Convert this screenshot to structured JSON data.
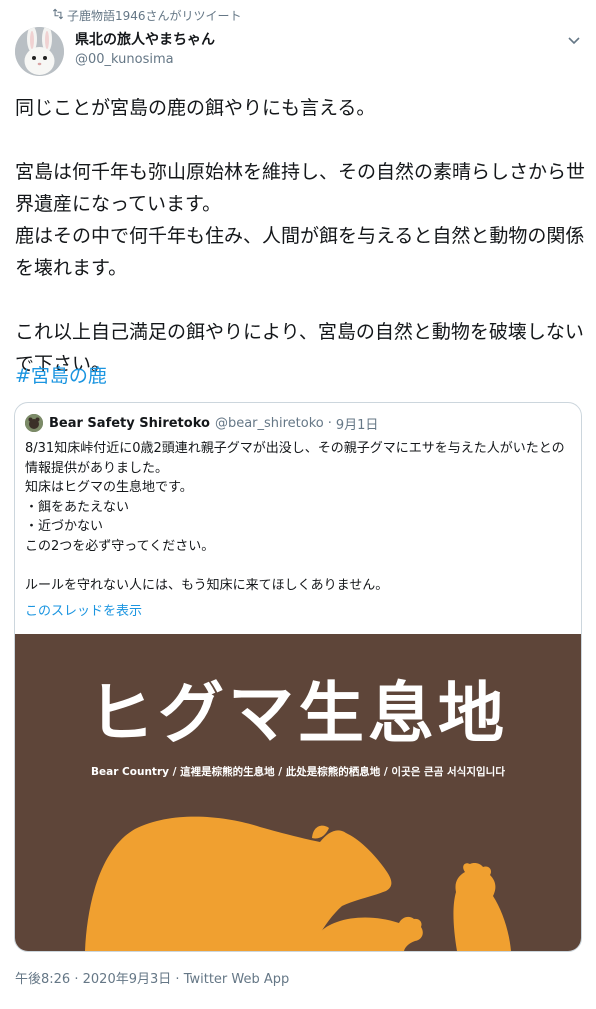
{
  "retweet": {
    "label": "子鹿物語1946さんがリツイート",
    "icon": "retweet-icon"
  },
  "author": {
    "name": "県北の旅人やまちゃん",
    "handle": "@00_kunosima",
    "avatar_icon": "rabbit-avatar"
  },
  "tweet": {
    "text": "同じことが宮島の鹿の餌やりにも言える。\n\n宮島は何千年も弥山原始林を維持し、その自然の素晴らしさから世界遺産になっています。\n鹿はその中で何千年も住み、人間が餌を与えると自然と動物の関係を壊れます。\n\nこれ以上自己満足の餌やりにより、宮島の自然と動物を破壊しないで下さい。",
    "hashtag": "#宮島の鹿"
  },
  "quote": {
    "name": "Bear Safety Shiretoko",
    "handle": "@bear_shiretoko",
    "separator": "·",
    "date": "9月1日",
    "text": "8/31知床峠付近に0歳2頭連れ親子グマが出没し、その親子グマにエサを与えた人がいたとの情報提供がありました。\n知床はヒグマの生息地です。\n・餌をあたえない\n・近づかない\nこの2つを必ず守ってください。\n\nルールを守れない人には、もう知床に来てほしくありません。",
    "thread_link": "このスレッドを表示",
    "image": {
      "title": "ヒグマ生息地",
      "subtitle": "Bear Country / 這裡是棕熊的生息地 / 此处是棕熊的栖息地 / 이곳은 큰곰 서식지입니다",
      "background": "#5e4539",
      "bear_color": "#f0a030"
    }
  },
  "meta": {
    "time": "午後8:26",
    "separator": "·",
    "date": "2020年9月3日",
    "source": "Twitter Web App"
  },
  "colors": {
    "link": "#1b95e0",
    "secondary": "#657786",
    "border": "#ccd6dd"
  }
}
